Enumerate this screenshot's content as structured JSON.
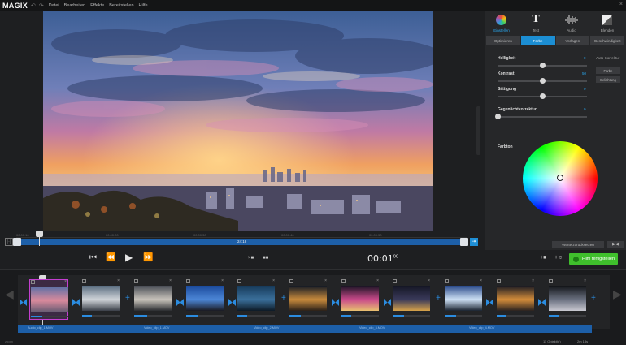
{
  "app": {
    "logo": "MAGIX",
    "menu": [
      "Datei",
      "Bearbeiten",
      "Effekte",
      "Bereitstellen",
      "Hilfe"
    ],
    "undo": "↶",
    "redo": "↷",
    "close": "×"
  },
  "scrubber": {
    "ticks": [
      "00:00:10",
      "00:00:20",
      "00:00:30",
      "00:00:40",
      "00:00:50"
    ],
    "time": "24:18",
    "playhead_fraction": 0.05
  },
  "transport": {
    "timecode": "00:01",
    "timecode_frames": "00",
    "export_label": "Film fertigstellen",
    "mode_a": "×■",
    "mode_b": "■■",
    "add_audio": "+■",
    "add_music": "+♫"
  },
  "panel": {
    "tabs": [
      {
        "label": "Einstellen",
        "active": true
      },
      {
        "label": "Text",
        "active": false
      },
      {
        "label": "Audio",
        "active": false
      },
      {
        "label": "Blenden",
        "active": false
      }
    ],
    "subtabs": [
      {
        "label": "Optimieren",
        "active": false
      },
      {
        "label": "Farbe",
        "active": true
      },
      {
        "label": "Vorlagen",
        "active": false
      },
      {
        "label": "Geschwindigkeit",
        "active": false
      }
    ],
    "sliders": [
      {
        "label": "Helligkeit",
        "value": "0",
        "fraction": 0.5
      },
      {
        "label": "Kontrast",
        "value": "50",
        "fraction": 0.5
      },
      {
        "label": "Sättigung",
        "value": "0",
        "fraction": 0.5
      },
      {
        "label": "Gegenlichtkorrektur",
        "value": "0",
        "fraction": 0.0
      }
    ],
    "auto_label": "Auto-Korrektur",
    "auto_buttons": [
      "Farbe",
      "Belichtung"
    ],
    "farbton_label": "Farbton",
    "reset_label": "Werte zurücksetzen",
    "apply_all_label": "▶◀"
  },
  "storyboard": {
    "audio_labels": [
      "Audio_clip_1.MOV",
      "Video_clip_1.MOV",
      "Video_clip_2.MOV",
      "Video_clip_3.MOV",
      "Video_clip_4.MOV"
    ],
    "status_a": "11 Objekt(e)",
    "status_b": "2m 18s",
    "zoom_label": "zoom"
  }
}
